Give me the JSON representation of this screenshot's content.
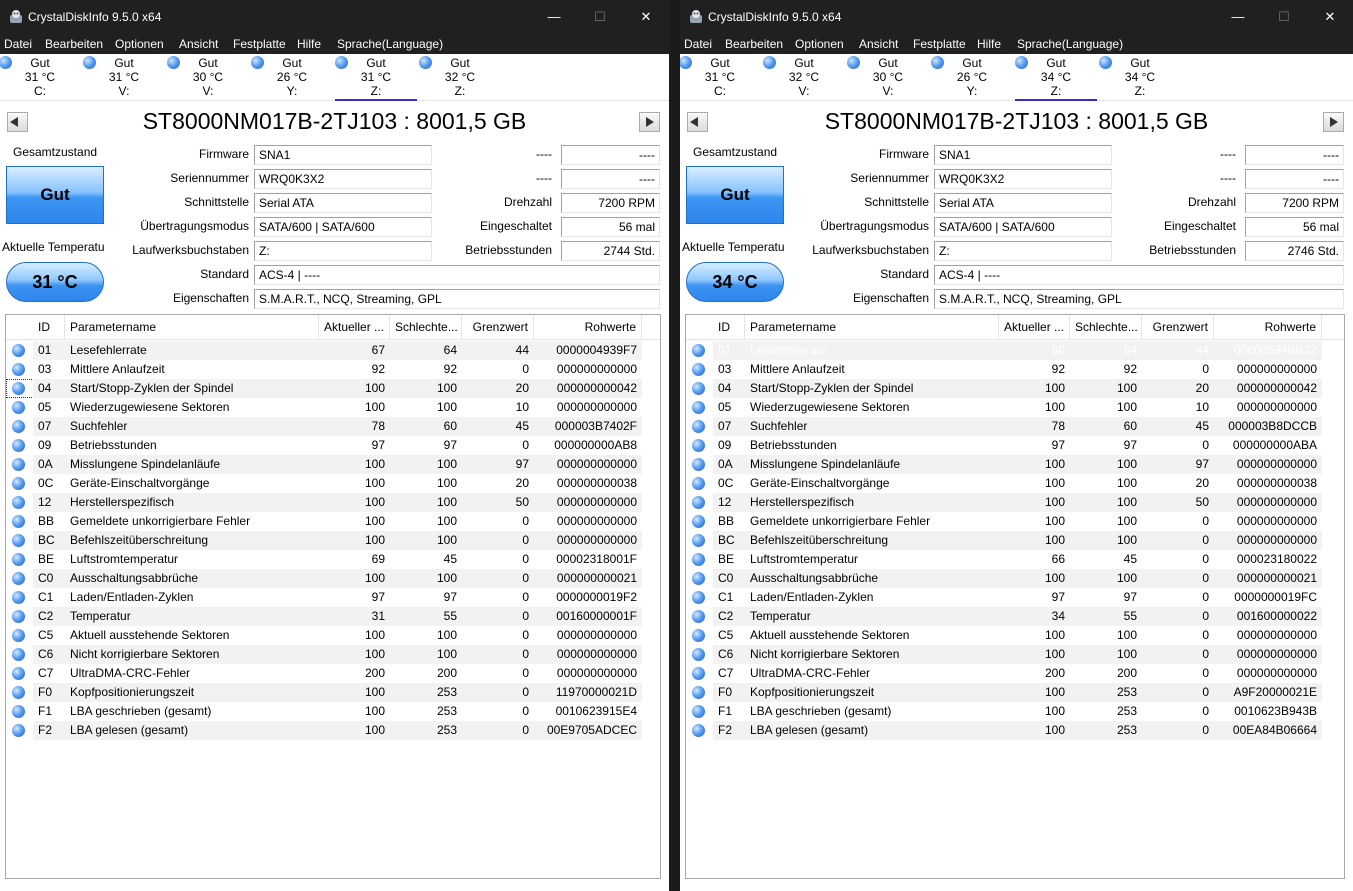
{
  "windows": [
    {
      "title": "CrystalDiskInfo 9.5.0 x64",
      "menu": [
        "Datei",
        "Bearbeiten",
        "Optionen",
        "Ansicht",
        "Festplatte",
        "Hilfe",
        "Sprache(Language)"
      ],
      "drives": [
        {
          "status": "Gut",
          "temp": "31 °C",
          "letter": "C:"
        },
        {
          "status": "Gut",
          "temp": "31 °C",
          "letter": "V:"
        },
        {
          "status": "Gut",
          "temp": "30 °C",
          "letter": "V:"
        },
        {
          "status": "Gut",
          "temp": "26 °C",
          "letter": "Y:"
        },
        {
          "status": "Gut",
          "temp": "31 °C",
          "letter": "Z:"
        },
        {
          "status": "Gut",
          "temp": "32 °C",
          "letter": "Z:"
        }
      ],
      "selected_drive": 4,
      "model": "ST8000NM017B-2TJ103 : 8001,5 GB",
      "health_label": "Gesamtzustand",
      "health_value": "Gut",
      "temp_label": "Aktuelle Temperatu",
      "temp_value": "31 °C",
      "fields": {
        "firmware_label": "Firmware",
        "firmware": "SNA1",
        "serial_label": "Seriennummer",
        "serial": "WRQ0K3X2",
        "interface_label": "Schnittstelle",
        "interface": "Serial ATA",
        "transfer_label": "Übertragungsmodus",
        "transfer": "SATA/600 | SATA/600",
        "letters_label": "Laufwerksbuchstaben",
        "letters": "Z:",
        "standard_label": "Standard",
        "standard": "ACS-4 | ----",
        "features_label": "Eigenschaften",
        "features": "S.M.A.R.T., NCQ, Streaming, GPL",
        "blank1_label": "----",
        "blank1": "----",
        "blank2_label": "----",
        "blank2": "----",
        "rpm_label": "Drehzahl",
        "rpm": "7200 RPM",
        "power_on_count_label": "Eingeschaltet",
        "power_on_count": "56 mal",
        "power_on_hours_label": "Betriebsstunden",
        "power_on_hours": "2744 Std."
      },
      "columns": [
        "ID",
        "Parametername",
        "Aktueller ...",
        "Schlechte...",
        "Grenzwert",
        "Rohwerte"
      ],
      "rows": [
        [
          "01",
          "Lesefehlerrate",
          "67",
          "64",
          "44",
          "0000004939F7"
        ],
        [
          "03",
          "Mittlere Anlaufzeit",
          "92",
          "92",
          "0",
          "000000000000"
        ],
        [
          "04",
          "Start/Stopp-Zyklen der Spindel",
          "100",
          "100",
          "20",
          "000000000042"
        ],
        [
          "05",
          "Wiederzugewiesene Sektoren",
          "100",
          "100",
          "10",
          "000000000000"
        ],
        [
          "07",
          "Suchfehler",
          "78",
          "60",
          "45",
          "000003B7402F"
        ],
        [
          "09",
          "Betriebsstunden",
          "97",
          "97",
          "0",
          "000000000AB8"
        ],
        [
          "0A",
          "Misslungene Spindelanläufe",
          "100",
          "100",
          "97",
          "000000000000"
        ],
        [
          "0C",
          "Geräte-Einschaltvorgänge",
          "100",
          "100",
          "20",
          "000000000038"
        ],
        [
          "12",
          "Herstellerspezifisch",
          "100",
          "100",
          "50",
          "000000000000"
        ],
        [
          "BB",
          "Gemeldete unkorrigierbare Fehler",
          "100",
          "100",
          "0",
          "000000000000"
        ],
        [
          "BC",
          "Befehlszeitüberschreitung",
          "100",
          "100",
          "0",
          "000000000000"
        ],
        [
          "BE",
          "Luftstromtemperatur",
          "69",
          "45",
          "0",
          "00002318001F"
        ],
        [
          "C0",
          "Ausschaltungsabbrüche",
          "100",
          "100",
          "0",
          "000000000021"
        ],
        [
          "C1",
          "Laden/Entladen-Zyklen",
          "97",
          "97",
          "0",
          "0000000019F2"
        ],
        [
          "C2",
          "Temperatur",
          "31",
          "55",
          "0",
          "00160000001F"
        ],
        [
          "C5",
          "Aktuell ausstehende Sektoren",
          "100",
          "100",
          "0",
          "000000000000"
        ],
        [
          "C6",
          "Nicht korrigierbare Sektoren",
          "100",
          "100",
          "0",
          "000000000000"
        ],
        [
          "C7",
          "UltraDMA-CRC-Fehler",
          "200",
          "200",
          "0",
          "000000000000"
        ],
        [
          "F0",
          "Kopfpositionierungszeit",
          "100",
          "253",
          "0",
          "11970000021D"
        ],
        [
          "F1",
          "LBA geschrieben (gesamt)",
          "100",
          "253",
          "0",
          "0010623915E4"
        ],
        [
          "F2",
          "LBA gelesen (gesamt)",
          "100",
          "253",
          "0",
          "00E9705ADCEC"
        ]
      ],
      "selected_row": -1,
      "focused_row": 2
    },
    {
      "title": "CrystalDiskInfo 9.5.0 x64",
      "menu": [
        "Datei",
        "Bearbeiten",
        "Optionen",
        "Ansicht",
        "Festplatte",
        "Hilfe",
        "Sprache(Language)"
      ],
      "drives": [
        {
          "status": "Gut",
          "temp": "31 °C",
          "letter": "C:"
        },
        {
          "status": "Gut",
          "temp": "32 °C",
          "letter": "V:"
        },
        {
          "status": "Gut",
          "temp": "30 °C",
          "letter": "V:"
        },
        {
          "status": "Gut",
          "temp": "26 °C",
          "letter": "Y:"
        },
        {
          "status": "Gut",
          "temp": "34 °C",
          "letter": "Z:"
        },
        {
          "status": "Gut",
          "temp": "34 °C",
          "letter": "Z:"
        }
      ],
      "selected_drive": 4,
      "model": "ST8000NM017B-2TJ103 : 8001,5 GB",
      "health_label": "Gesamtzustand",
      "health_value": "Gut",
      "temp_label": "Aktuelle Temperatu",
      "temp_value": "34 °C",
      "fields": {
        "firmware_label": "Firmware",
        "firmware": "SNA1",
        "serial_label": "Seriennummer",
        "serial": "WRQ0K3X2",
        "interface_label": "Schnittstelle",
        "interface": "Serial ATA",
        "transfer_label": "Übertragungsmodus",
        "transfer": "SATA/600 | SATA/600",
        "letters_label": "Laufwerksbuchstaben",
        "letters": "Z:",
        "standard_label": "Standard",
        "standard": "ACS-4 | ----",
        "features_label": "Eigenschaften",
        "features": "S.M.A.R.T., NCQ, Streaming, GPL",
        "blank1_label": "----",
        "blank1": "----",
        "blank2_label": "----",
        "blank2": "----",
        "rpm_label": "Drehzahl",
        "rpm": "7200 RPM",
        "power_on_count_label": "Eingeschaltet",
        "power_on_count": "56 mal",
        "power_on_hours_label": "Betriebsstunden",
        "power_on_hours": "2746 Std."
      },
      "columns": [
        "ID",
        "Parametername",
        "Aktueller ...",
        "Schlechte...",
        "Grenzwert",
        "Rohwerte"
      ],
      "rows": [
        [
          "01",
          "Lesefehlerrate",
          "80",
          "64",
          "44",
          "00000594BB22"
        ],
        [
          "03",
          "Mittlere Anlaufzeit",
          "92",
          "92",
          "0",
          "000000000000"
        ],
        [
          "04",
          "Start/Stopp-Zyklen der Spindel",
          "100",
          "100",
          "20",
          "000000000042"
        ],
        [
          "05",
          "Wiederzugewiesene Sektoren",
          "100",
          "100",
          "10",
          "000000000000"
        ],
        [
          "07",
          "Suchfehler",
          "78",
          "60",
          "45",
          "000003B8DCCB"
        ],
        [
          "09",
          "Betriebsstunden",
          "97",
          "97",
          "0",
          "000000000ABA"
        ],
        [
          "0A",
          "Misslungene Spindelanläufe",
          "100",
          "100",
          "97",
          "000000000000"
        ],
        [
          "0C",
          "Geräte-Einschaltvorgänge",
          "100",
          "100",
          "20",
          "000000000038"
        ],
        [
          "12",
          "Herstellerspezifisch",
          "100",
          "100",
          "50",
          "000000000000"
        ],
        [
          "BB",
          "Gemeldete unkorrigierbare Fehler",
          "100",
          "100",
          "0",
          "000000000000"
        ],
        [
          "BC",
          "Befehlszeitüberschreitung",
          "100",
          "100",
          "0",
          "000000000000"
        ],
        [
          "BE",
          "Luftstromtemperatur",
          "66",
          "45",
          "0",
          "000023180022"
        ],
        [
          "C0",
          "Ausschaltungsabbrüche",
          "100",
          "100",
          "0",
          "000000000021"
        ],
        [
          "C1",
          "Laden/Entladen-Zyklen",
          "97",
          "97",
          "0",
          "0000000019FC"
        ],
        [
          "C2",
          "Temperatur",
          "34",
          "55",
          "0",
          "001600000022"
        ],
        [
          "C5",
          "Aktuell ausstehende Sektoren",
          "100",
          "100",
          "0",
          "000000000000"
        ],
        [
          "C6",
          "Nicht korrigierbare Sektoren",
          "100",
          "100",
          "0",
          "000000000000"
        ],
        [
          "C7",
          "UltraDMA-CRC-Fehler",
          "200",
          "200",
          "0",
          "000000000000"
        ],
        [
          "F0",
          "Kopfpositionierungszeit",
          "100",
          "253",
          "0",
          "A9F20000021E"
        ],
        [
          "F1",
          "LBA geschrieben (gesamt)",
          "100",
          "253",
          "0",
          "0010623B943B"
        ],
        [
          "F2",
          "LBA gelesen (gesamt)",
          "100",
          "253",
          "0",
          "00EA84B06664"
        ]
      ],
      "selected_row": 0,
      "focused_row": -1
    }
  ],
  "colors": {
    "health_blue": "#3c95f2",
    "selection": "#1f73d8",
    "titlebar": "#202020"
  }
}
